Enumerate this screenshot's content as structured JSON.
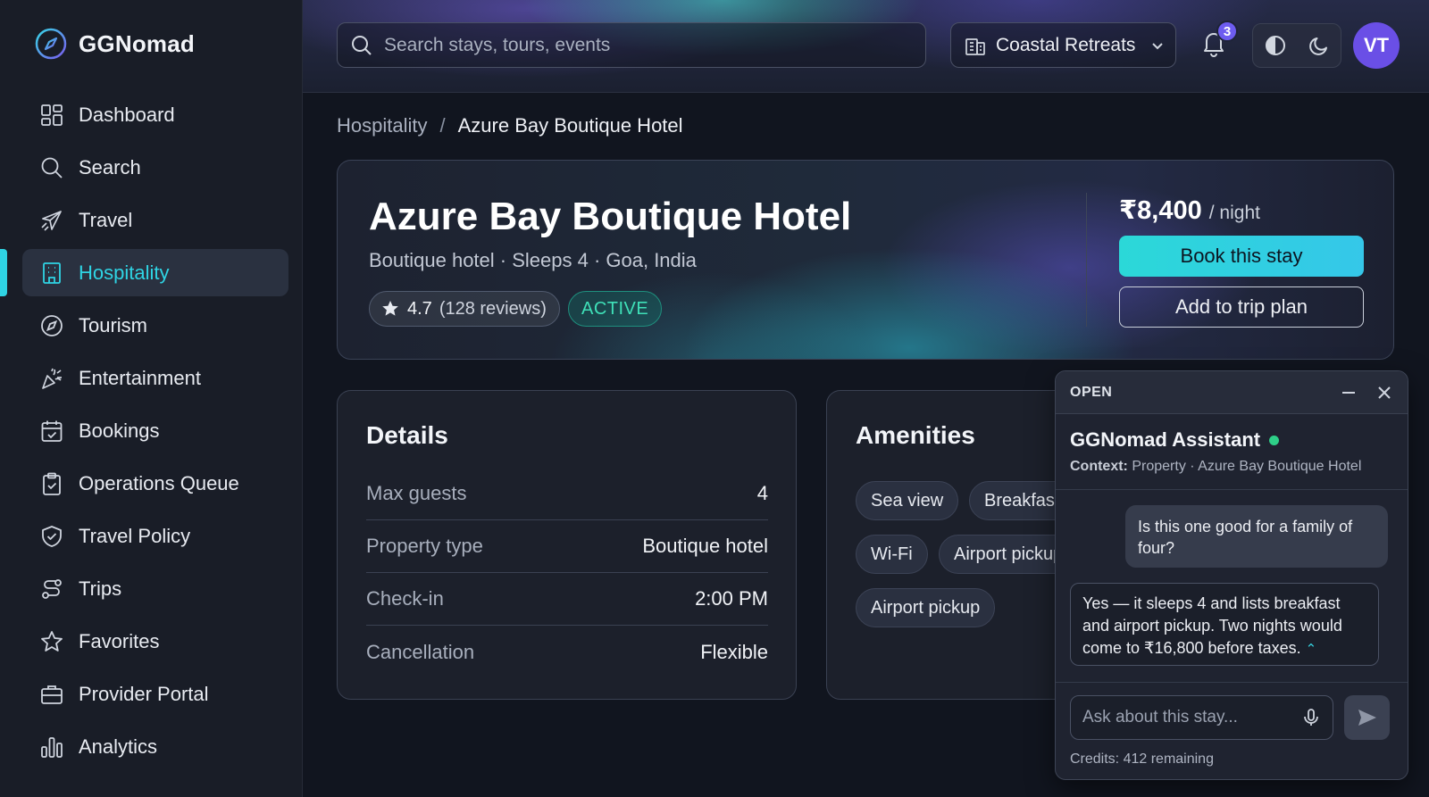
{
  "brand": {
    "name": "GGNomad"
  },
  "sidebar": {
    "items": [
      {
        "label": "Dashboard",
        "icon": "dashboard-icon"
      },
      {
        "label": "Search",
        "icon": "search-icon"
      },
      {
        "label": "Travel",
        "icon": "plane-icon"
      },
      {
        "label": "Hospitality",
        "icon": "building-icon",
        "active": true
      },
      {
        "label": "Tourism",
        "icon": "compass-icon"
      },
      {
        "label": "Entertainment",
        "icon": "party-popper-icon"
      },
      {
        "label": "Bookings",
        "icon": "calendar-check-icon"
      },
      {
        "label": "Operations Queue",
        "icon": "clipboard-check-icon"
      },
      {
        "label": "Travel Policy",
        "icon": "shield-check-icon"
      },
      {
        "label": "Trips",
        "icon": "route-icon"
      },
      {
        "label": "Favorites",
        "icon": "star-icon"
      },
      {
        "label": "Provider Portal",
        "icon": "briefcase-icon"
      },
      {
        "label": "Analytics",
        "icon": "bar-chart-icon"
      }
    ]
  },
  "topbar": {
    "search_placeholder": "Search stays, tours, events",
    "workspace": "Coastal Retreats",
    "notifications_count": "3",
    "avatar_initials": "VT"
  },
  "breadcrumb": {
    "parent": "Hospitality",
    "separator": "/",
    "current": "Azure Bay Boutique Hotel"
  },
  "property": {
    "name": "Azure Bay Boutique Hotel",
    "subtitle": "Boutique hotel · Sleeps 4 · Goa, India",
    "rating": "4.7",
    "reviews": "(128 reviews)",
    "status": "ACTIVE",
    "price": "₹8,400",
    "price_unit": "/ night",
    "book_label": "Book this stay",
    "plan_label": "Add to trip plan"
  },
  "details": {
    "title": "Details",
    "rows": [
      {
        "label": "Max guests",
        "value": "4"
      },
      {
        "label": "Property type",
        "value": "Boutique hotel"
      },
      {
        "label": "Check-in",
        "value": "2:00 PM"
      },
      {
        "label": "Cancellation",
        "value": "Flexible"
      }
    ]
  },
  "amenities": {
    "title": "Amenities",
    "items": [
      "Sea view",
      "Breakfast",
      "Wi-Fi",
      "Airport pickup",
      "Airport pickup"
    ]
  },
  "assistant": {
    "state": "OPEN",
    "title": "GGNomad Assistant",
    "context_label": "Context:",
    "context_value": "Property · Azure Bay Boutique Hotel",
    "user_message": "Is this one good for a family of four?",
    "bot_message": "Yes — it sleeps 4 and lists breakfast and airport pickup. Two nights would come to ₹16,800 before taxes.",
    "input_placeholder": "Ask about this stay...",
    "credits": "Credits: 412 remaining"
  },
  "colors": {
    "accent": "#2fd4e4",
    "status_green": "#3fe0b8",
    "avatar": "#6a4fe6",
    "online_dot": "#2ecf88"
  }
}
